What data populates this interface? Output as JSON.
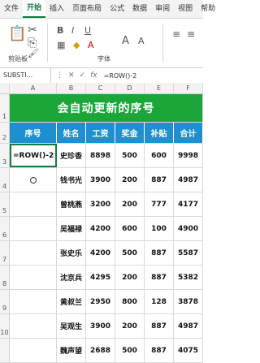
{
  "tabs": [
    "文件",
    "开始",
    "插入",
    "页面布局",
    "公式",
    "数据",
    "审阅",
    "视图",
    "帮助"
  ],
  "active_tab": "开始",
  "ribbon": {
    "paste_label": "剪贴板",
    "font_label": "字体"
  },
  "formula_bar": {
    "name_box": "SUBSTI...",
    "cancel": "✕",
    "enter": "✓",
    "fx": "fx",
    "formula": "=ROW()-2"
  },
  "columns": [
    "A",
    "B",
    "C",
    "D",
    "E",
    "F"
  ],
  "rows": [
    "1",
    "2",
    "3",
    "4",
    "5",
    "6",
    "7",
    "8",
    "9",
    "10"
  ],
  "title": "会自动更新的序号",
  "headers": [
    "序号",
    "姓名",
    "工资",
    "奖金",
    "补贴",
    "合计"
  ],
  "editing_cell": "=ROW()-2",
  "data_rows": [
    {
      "name": "史珍香",
      "salary": "8898",
      "bonus": "500",
      "allow": "600",
      "total": "9998"
    },
    {
      "name": "钱书光",
      "salary": "3900",
      "bonus": "200",
      "allow": "887",
      "total": "4987"
    },
    {
      "name": "曾桃燕",
      "salary": "3200",
      "bonus": "200",
      "allow": "777",
      "total": "4177"
    },
    {
      "name": "吴福禄",
      "salary": "4200",
      "bonus": "600",
      "allow": "100",
      "total": "4900"
    },
    {
      "name": "张史乐",
      "salary": "4200",
      "bonus": "500",
      "allow": "887",
      "total": "5587"
    },
    {
      "name": "沈京兵",
      "salary": "4295",
      "bonus": "200",
      "allow": "887",
      "total": "5382"
    },
    {
      "name": "黄叔兰",
      "salary": "2950",
      "bonus": "800",
      "allow": "128",
      "total": "3878"
    },
    {
      "name": "吴观生",
      "salary": "3900",
      "bonus": "200",
      "allow": "887",
      "total": "4987"
    },
    {
      "name": "魏声望",
      "salary": "2688",
      "bonus": "500",
      "allow": "887",
      "total": "4075"
    }
  ]
}
